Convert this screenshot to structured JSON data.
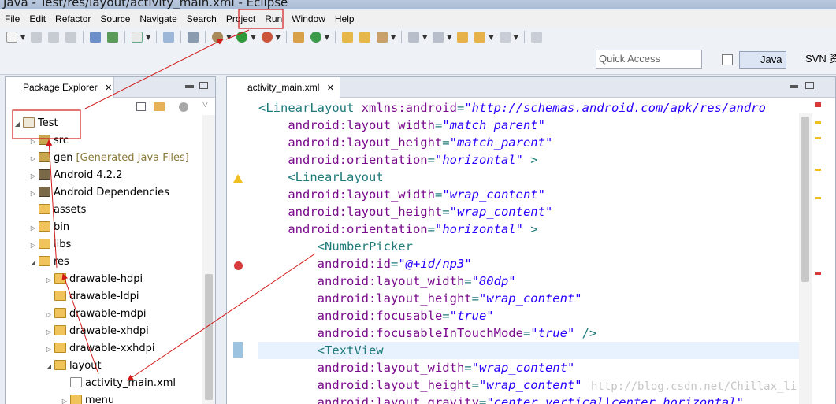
{
  "window": {
    "title": "Java - Test/res/layout/activity_main.xml - Eclipse"
  },
  "menu": [
    "File",
    "Edit",
    "Refactor",
    "Source",
    "Navigate",
    "Search",
    "Project",
    "Run",
    "Window",
    "Help"
  ],
  "toolbar": {
    "quick_access_placeholder": "Quick Access",
    "perspectives": {
      "java": "Java",
      "svn": "SVN 资"
    }
  },
  "package_explorer": {
    "title": "Package Explorer",
    "tree": [
      {
        "label": "Test",
        "note": "",
        "expanded": true,
        "icon": "project-icon"
      },
      {
        "label": "src",
        "note": "",
        "expanded": false,
        "icon": "source-folder-icon"
      },
      {
        "label": "gen",
        "note": "[Generated Java Files]",
        "expanded": false,
        "icon": "source-folder-icon"
      },
      {
        "label": "Android 4.2.2",
        "note": "",
        "expanded": false,
        "icon": "library-icon"
      },
      {
        "label": "Android Dependencies",
        "note": "",
        "expanded": false,
        "icon": "library-icon"
      },
      {
        "label": "assets",
        "note": "",
        "expanded": null,
        "icon": "folder-icon"
      },
      {
        "label": "bin",
        "note": "",
        "expanded": false,
        "icon": "folder-icon"
      },
      {
        "label": "libs",
        "note": "",
        "expanded": false,
        "icon": "folder-icon"
      },
      {
        "label": "res",
        "note": "",
        "expanded": true,
        "icon": "folder-icon"
      },
      {
        "label": "drawable-hdpi",
        "note": "",
        "expanded": false,
        "icon": "folder-icon"
      },
      {
        "label": "drawable-ldpi",
        "note": "",
        "expanded": null,
        "icon": "folder-icon"
      },
      {
        "label": "drawable-mdpi",
        "note": "",
        "expanded": false,
        "icon": "folder-icon"
      },
      {
        "label": "drawable-xhdpi",
        "note": "",
        "expanded": false,
        "icon": "folder-icon"
      },
      {
        "label": "drawable-xxhdpi",
        "note": "",
        "expanded": false,
        "icon": "folder-icon"
      },
      {
        "label": "layout",
        "note": "",
        "expanded": true,
        "icon": "folder-icon"
      },
      {
        "label": "activity_main.xml",
        "note": "",
        "expanded": null,
        "icon": "xml-file-icon"
      },
      {
        "label": "menu",
        "note": "",
        "expanded": false,
        "icon": "folder-icon"
      }
    ]
  },
  "editor": {
    "tab": "activity_main.xml",
    "lines": [
      {
        "parts": [
          [
            "tag",
            "<LinearLayout "
          ],
          [
            "attr",
            "xmlns:android"
          ],
          [
            "punc",
            "="
          ],
          [
            "val",
            "\"http://schemas.android.com/apk/res/andro"
          ]
        ]
      },
      {
        "parts": [
          [
            "attr",
            "    android:layout_width"
          ],
          [
            "punc",
            "="
          ],
          [
            "val",
            "\"match_parent\""
          ]
        ]
      },
      {
        "parts": [
          [
            "attr",
            "    android:layout_height"
          ],
          [
            "punc",
            "="
          ],
          [
            "val",
            "\"match_parent\""
          ]
        ]
      },
      {
        "parts": [
          [
            "attr",
            "    android:orientation"
          ],
          [
            "punc",
            "="
          ],
          [
            "val",
            "\"horizontal\""
          ],
          [
            "punc",
            " >"
          ]
        ]
      },
      {
        "parts": [
          [
            "tag",
            "    <LinearLayout"
          ]
        ]
      },
      {
        "parts": [
          [
            "attr",
            "    android:layout_width"
          ],
          [
            "punc",
            "="
          ],
          [
            "val",
            "\"wrap_content\""
          ]
        ]
      },
      {
        "parts": [
          [
            "attr",
            "    android:layout_height"
          ],
          [
            "punc",
            "="
          ],
          [
            "val",
            "\"wrap_content\""
          ]
        ]
      },
      {
        "parts": [
          [
            "attr",
            "    android:orientation"
          ],
          [
            "punc",
            "="
          ],
          [
            "val",
            "\"horizontal\""
          ],
          [
            "punc",
            " >"
          ]
        ]
      },
      {
        "parts": [
          [
            "tag",
            "        <NumberPicker"
          ]
        ]
      },
      {
        "parts": [
          [
            "attr",
            "        android:id"
          ],
          [
            "punc",
            "="
          ],
          [
            "val",
            "\"@+id/np3\""
          ]
        ]
      },
      {
        "parts": [
          [
            "attr",
            "        android:layout_width"
          ],
          [
            "punc",
            "="
          ],
          [
            "val",
            "\"80dp\""
          ]
        ]
      },
      {
        "parts": [
          [
            "attr",
            "        android:layout_height"
          ],
          [
            "punc",
            "="
          ],
          [
            "val",
            "\"wrap_content\""
          ]
        ]
      },
      {
        "parts": [
          [
            "attr",
            "        android:focusable"
          ],
          [
            "punc",
            "="
          ],
          [
            "val",
            "\"true\""
          ]
        ]
      },
      {
        "parts": [
          [
            "attr",
            "        android:focusableInTouchMode"
          ],
          [
            "punc",
            "="
          ],
          [
            "val",
            "\"true\""
          ],
          [
            "punc",
            " />"
          ]
        ]
      },
      {
        "parts": [
          [
            "tag",
            "        <TextView"
          ]
        ]
      },
      {
        "parts": [
          [
            "attr",
            "        android:layout_width"
          ],
          [
            "punc",
            "="
          ],
          [
            "val",
            "\"wrap_content\""
          ]
        ]
      },
      {
        "parts": [
          [
            "attr",
            "        android:layout_height"
          ],
          [
            "punc",
            "="
          ],
          [
            "val",
            "\"wrap_content\""
          ]
        ]
      },
      {
        "parts": [
          [
            "attr",
            "        android:layout_gravity"
          ],
          [
            "punc",
            "="
          ],
          [
            "val",
            "\"center_vertical|center_horizontal\""
          ]
        ]
      }
    ],
    "warning_line": 5,
    "error_line": 9,
    "highlight_line": 14
  },
  "watermark": "http://blog.csdn.net/Chillax_li",
  "colors": {
    "annotation": "#d21a1a"
  }
}
